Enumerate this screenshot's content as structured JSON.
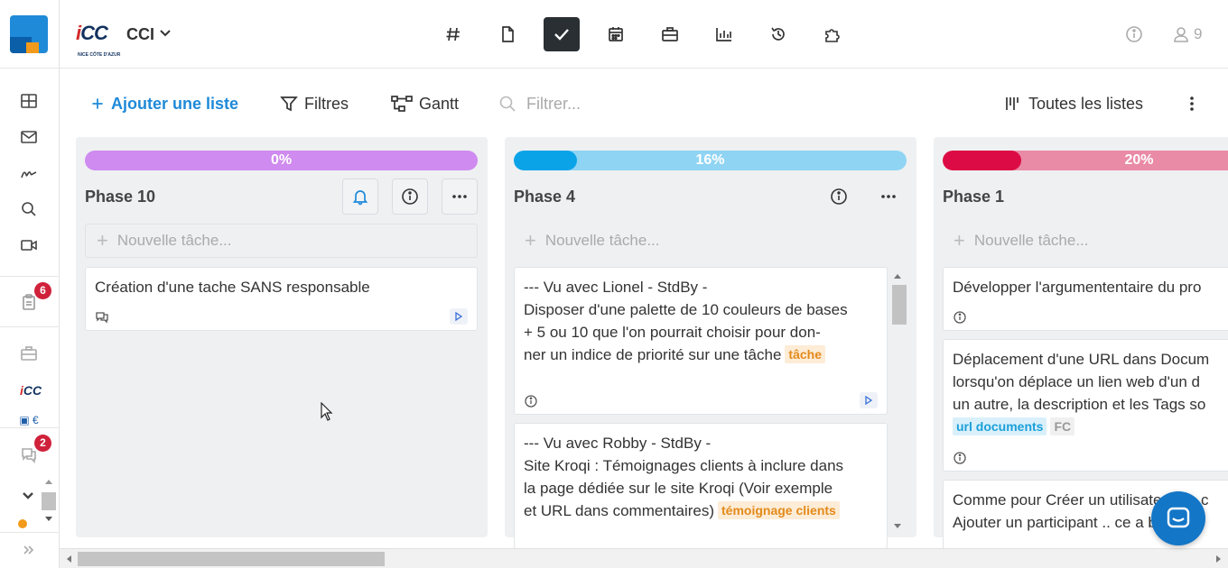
{
  "colors": {
    "accent": "#1f8ad8",
    "topbar_active_bg": "#2a2f33",
    "badge_red": "#d0213b",
    "phase10_track": "#cf8bef",
    "phase4_track": "#90d4f3",
    "phase4_fill": "#0ba3e8",
    "phase1_track": "#e98aa6",
    "phase1_fill": "#dd0b45",
    "chat_button": "#1376c7"
  },
  "rail": {
    "icons": [
      "grid-icon",
      "mail-icon",
      "signature-icon",
      "search-icon",
      "video-icon",
      "clipboard-icon",
      "briefcase-icon",
      "workspace-logo-icon",
      "workspace-logo2-icon",
      "chat-icon",
      "chevron-down-icon",
      "expand-icon"
    ],
    "clipboard_badge": "6",
    "chat_badge": "2",
    "mini_logo": "CC"
  },
  "topbar": {
    "logo_text": "CC",
    "logo_subtext": "NICE CÔTE D'AZUR",
    "workspace_name": "CCI",
    "tabs": [
      "hash-icon",
      "document-icon",
      "tasks-check-icon",
      "calendar-icon",
      "briefcase-icon",
      "chart-icon",
      "history-icon",
      "puzzle-icon"
    ],
    "active_tab": "tasks-check-icon",
    "members_count": "9"
  },
  "toolbar": {
    "add_list": "Ajouter une liste",
    "filters": "Filtres",
    "gantt": "Gantt",
    "filter_placeholder": "Filtrer...",
    "all_lists": "Toutes les listes"
  },
  "columns": [
    {
      "title": "Phase 10",
      "progress_label": "0%",
      "progress": 0,
      "new_task_placeholder": "Nouvelle tâche...",
      "cards": [
        {
          "lines": [
            "Création d'une tache SANS responsable"
          ],
          "tags": []
        }
      ]
    },
    {
      "title": "Phase 4",
      "progress_label": "16%",
      "progress": 16,
      "new_task_placeholder": "Nouvelle tâche...",
      "cards": [
        {
          "lines": [
            "--- Vu avec Lionel - StdBy -",
            "Disposer d'une palette de 10 couleurs de bases",
            "+ 5 ou 10  que l'on pourrait choisir pour don-",
            "ner un indice de priorité sur une tâche"
          ],
          "tags": [
            "tâche"
          ]
        },
        {
          "lines": [
            "--- Vu avec Robby - StdBy -",
            "Site Kroqi : Témoignages clients à inclure dans",
            "la page dédiée sur le site Kroqi  (Voir exemple",
            "et URL dans commentaires)"
          ],
          "tags": [
            "témoignage clients"
          ]
        }
      ]
    },
    {
      "title": "Phase 1",
      "progress_label": "20%",
      "progress": 20,
      "new_task_placeholder": "Nouvelle tâche...",
      "cards": [
        {
          "lines": [
            "Développer l'argumententaire du pro"
          ],
          "tags": []
        },
        {
          "lines": [
            "Déplacement d'une URL dans Docum",
            "lorsqu'on déplace un lien web d'un d",
            "un autre, la description et les Tags so"
          ],
          "tags": [
            "url documents",
            "FC"
          ]
        },
        {
          "lines": [
            "Comme pour Créer un utilisateur en c",
            "Ajouter un participant .. ce a bien"
          ],
          "tags": []
        }
      ]
    }
  ]
}
